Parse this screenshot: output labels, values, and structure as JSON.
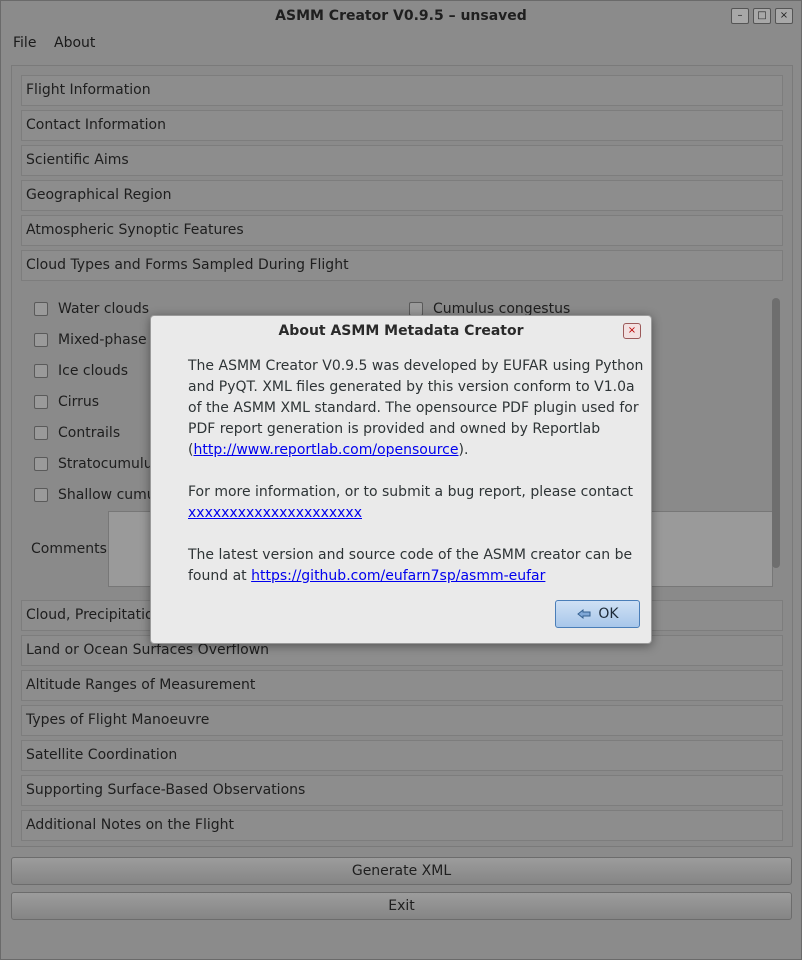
{
  "window": {
    "title": "ASMM Creator V0.9.5 – unsaved"
  },
  "titlebar_buttons": [
    "minimize-icon",
    "maximize-icon",
    "close-icon"
  ],
  "menu": {
    "file": "File",
    "about": "About"
  },
  "sections_top": [
    "Flight Information",
    "Contact Information",
    "Scientific Aims",
    "Geographical Region",
    "Atmospheric Synoptic Features",
    "Cloud Types and Forms Sampled During Flight"
  ],
  "cloud_types_left": [
    "Water clouds",
    "Mixed-phase cl",
    "Ice clouds",
    "Cirrus",
    "Contrails",
    "Stratocumulus",
    "Shallow cumulu"
  ],
  "cloud_types_right": [
    "Cumulus congestus"
  ],
  "comments_label": "Comments",
  "sections_bottom": [
    "Cloud, Precipitation",
    "Land or Ocean Surfaces Overflown",
    "Altitude Ranges of Measurement",
    "Types of Flight Manoeuvre",
    "Satellite Coordination",
    "Supporting Surface-Based Observations",
    "Additional Notes on the Flight"
  ],
  "buttons": {
    "generate": "Generate XML",
    "exit": "Exit"
  },
  "dialog": {
    "title": "About ASMM Metadata Creator",
    "para1": "The ASMM Creator V0.9.5 was developed by EUFAR using Python and PyQT. XML files generated by this version conform to V1.0a of the ASMM XML standard. The opensource PDF plugin used for PDF report generation is provided and owned by Reportlab (",
    "link1": "http://www.reportlab.com/opensource",
    "para1_end": ").",
    "para2": "For more information, or to submit a bug report, please contact",
    "link2": "xxxxxxxxxxxxxxxxxxxxx",
    "para3": "The latest version and source code of the ASMM creator can be found at ",
    "link3": "https://github.com/eufarn7sp/asmm-eufar",
    "ok": "OK"
  }
}
